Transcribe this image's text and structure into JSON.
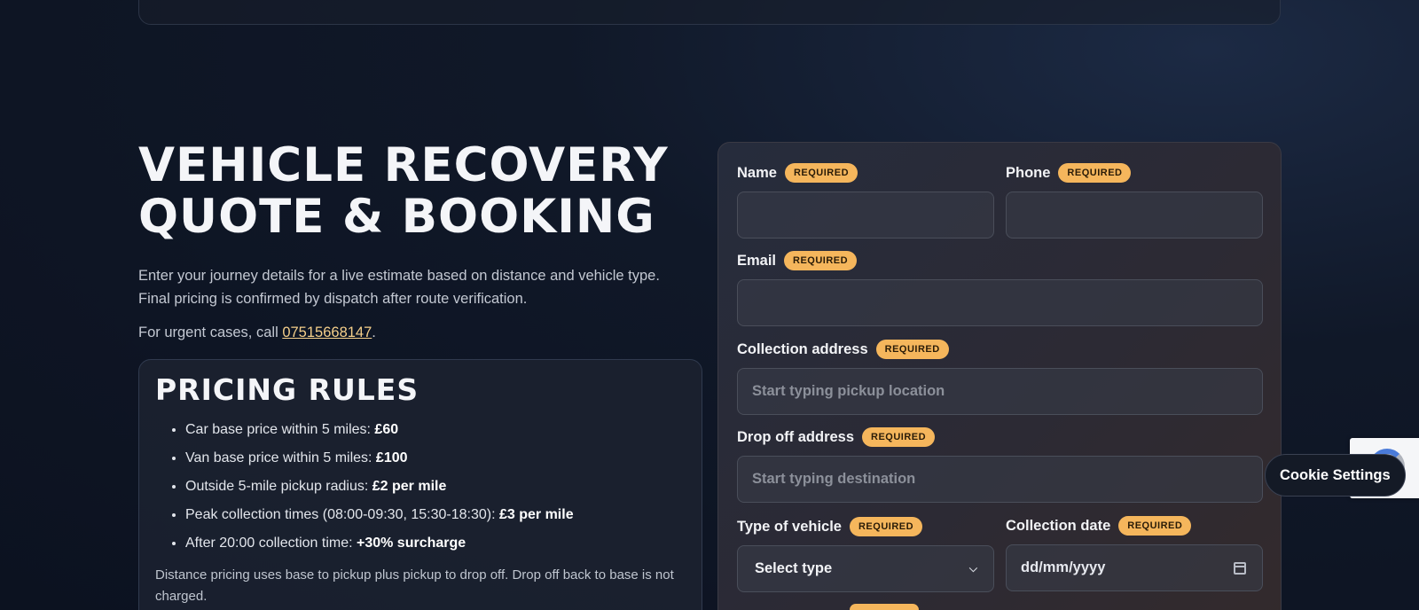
{
  "hero": {
    "title_line1": "VEHICLE RECOVERY",
    "title_line2": "QUOTE & BOOKING",
    "intro_line1": "Enter your journey details for a live estimate based on distance and vehicle type.",
    "intro_line2": "Final pricing is confirmed by dispatch after route verification.",
    "urgent_prefix": "For urgent cases, call ",
    "urgent_phone": "07515668147",
    "urgent_suffix": "."
  },
  "pricing": {
    "title": "PRICING RULES",
    "rules": [
      {
        "text": "Car base price within 5 miles: ",
        "value": "£60"
      },
      {
        "text": "Van base price within 5 miles: ",
        "value": "£100"
      },
      {
        "text": "Outside 5-mile pickup radius: ",
        "value": "£2 per mile"
      },
      {
        "text": "Peak collection times (08:00-09:30, 15:30-18:30): ",
        "value": "£3 per mile"
      },
      {
        "text": "After 20:00 collection time: ",
        "value": "+30% surcharge"
      }
    ],
    "note": "Distance pricing uses base to pickup plus pickup to drop off. Drop off back to base is not charged."
  },
  "form": {
    "required_badge": "REQUIRED",
    "name": {
      "label": "Name",
      "value": ""
    },
    "phone": {
      "label": "Phone",
      "value": ""
    },
    "email": {
      "label": "Email",
      "value": ""
    },
    "collection": {
      "label": "Collection address",
      "placeholder": "Start typing pickup location"
    },
    "dropoff": {
      "label": "Drop off address",
      "placeholder": "Start typing destination"
    },
    "vehicle": {
      "label": "Type of vehicle",
      "selected": "Select type"
    },
    "date": {
      "label": "Collection date",
      "value": "dd/mm/yyyy"
    }
  },
  "cookie": {
    "label": "Cookie Settings"
  },
  "colors": {
    "accent": "#f5b65c",
    "background": "#101828",
    "link": "#f4cf8a"
  },
  "icons": [
    "chevron-down-icon",
    "calendar-icon",
    "recaptcha-icon"
  ]
}
